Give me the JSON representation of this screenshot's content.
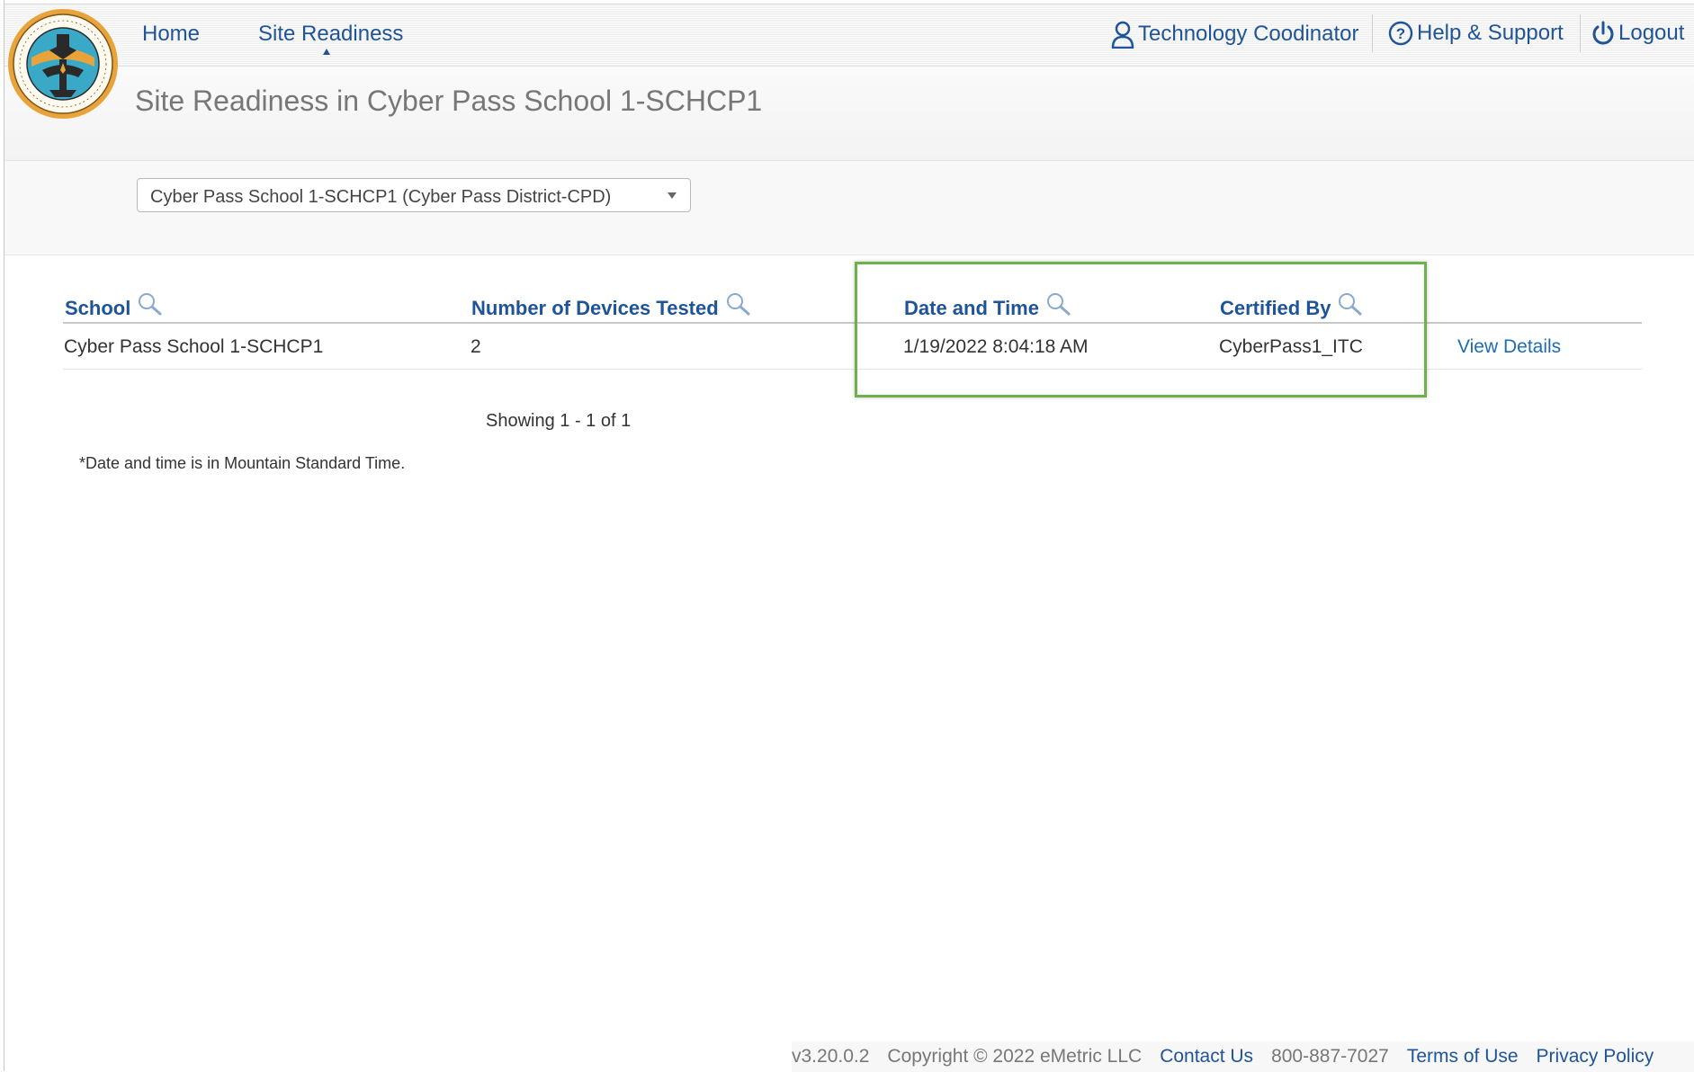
{
  "nav": {
    "home": "Home",
    "site_readiness": "Site Readiness"
  },
  "header": {
    "user_role": "Technology Coodinator",
    "help": "Help & Support",
    "logout": "Logout"
  },
  "page": {
    "title": "Site Readiness in Cyber Pass School 1-SCHCP1",
    "school_selector_value": "Cyber Pass School 1-SCHCP1 (Cyber Pass District-CPD)"
  },
  "table": {
    "headers": {
      "school": "School",
      "devices": "Number of Devices Tested",
      "datetime": "Date and Time",
      "certified": "Certified By"
    },
    "rows": [
      {
        "school": "Cyber Pass School 1-SCHCP1",
        "devices": "2",
        "datetime": "1/19/2022 8:04:18 AM",
        "certified": "CyberPass1_ITC",
        "action": "View Details"
      }
    ],
    "showing": "Showing 1 - 1 of 1",
    "note": "*Date and time is in Mountain Standard Time."
  },
  "footer": {
    "version": "v3.20.0.2",
    "copyright": "Copyright © 2022 eMetric LLC",
    "contact": "Contact Us",
    "phone": "800-887-7027",
    "terms": "Terms of Use",
    "privacy": "Privacy Policy"
  },
  "colors": {
    "link": "#1f5496",
    "highlight": "#6db14b"
  }
}
